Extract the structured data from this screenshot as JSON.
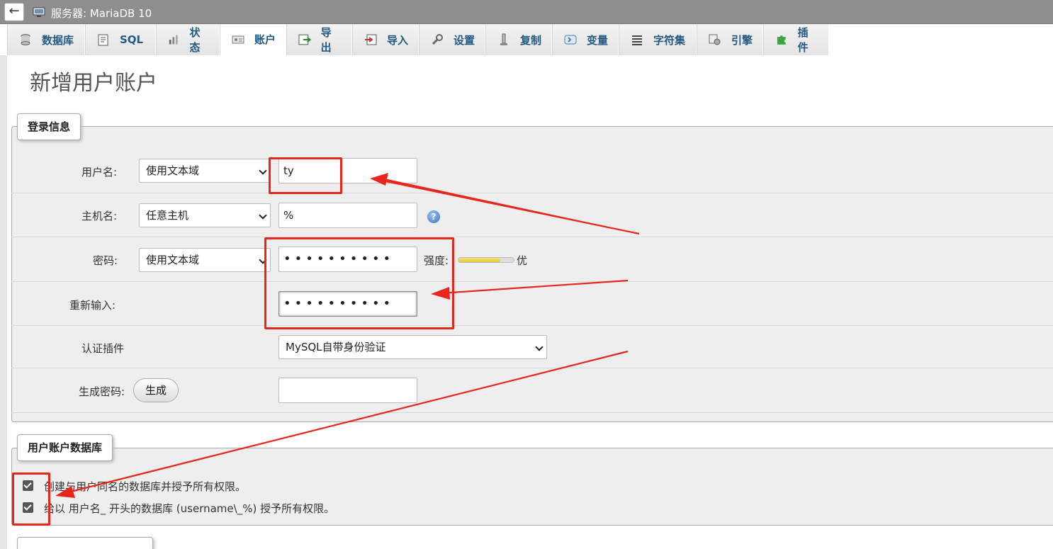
{
  "server": {
    "back_glyph": "←",
    "icon": "server-icon",
    "label": "服务器:  MariaDB 10"
  },
  "tabs": [
    {
      "label": "数据库",
      "icon": "database-icon"
    },
    {
      "label": "SQL",
      "icon": "sql-icon"
    },
    {
      "label": "状态",
      "icon": "status-icon"
    },
    {
      "label": "账户",
      "icon": "accounts-icon",
      "active": true
    },
    {
      "label": "导出",
      "icon": "export-icon"
    },
    {
      "label": "导入",
      "icon": "import-icon"
    },
    {
      "label": "设置",
      "icon": "settings-icon"
    },
    {
      "label": "复制",
      "icon": "replication-icon"
    },
    {
      "label": "变量",
      "icon": "variables-icon"
    },
    {
      "label": "字符集",
      "icon": "charset-icon"
    },
    {
      "label": "引擎",
      "icon": "engine-icon"
    },
    {
      "label": "插件",
      "icon": "plugin-icon"
    }
  ],
  "page": {
    "title": "新增用户账户"
  },
  "login": {
    "legend": "登录信息",
    "username_label": "用户名:",
    "username_type": "使用文本域",
    "username_value": "ty",
    "host_label": "主机名:",
    "host_type": "任意主机",
    "host_value": "%",
    "help_glyph": "?",
    "password_label": "密码:",
    "password_type": "使用文本域",
    "password_value": "••••••••••",
    "strength_label": "强度:",
    "strength_value": "优",
    "strength_level": 0.75,
    "reenter_label": "重新输入:",
    "reenter_value": "••••••••••",
    "auth_label": "认证插件",
    "auth_value": "MySQL自带身份验证",
    "generate_label": "生成密码:",
    "generate_button": "生成",
    "generate_value": ""
  },
  "userdb": {
    "legend": "用户账户数据库",
    "option1": "创建与用户同名的数据库并授予所有权限。",
    "option2": "给以 用户名_ 开头的数据库 (username\\_%) 授予所有权限。"
  },
  "colors": {
    "accent": "#235a81",
    "annotation": "#e8261c"
  }
}
